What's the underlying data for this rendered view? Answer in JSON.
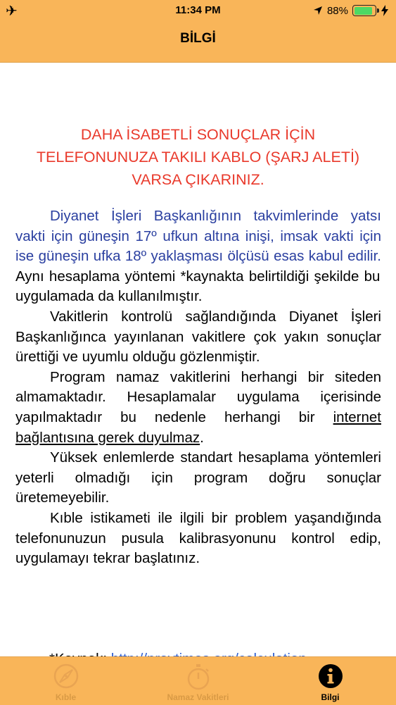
{
  "status_bar": {
    "time": "11:34 PM",
    "battery_percent": "88%",
    "battery_level": 0.88,
    "icons": [
      "airplane-icon",
      "location-arrow-icon",
      "battery-icon",
      "charging-bolt-icon"
    ]
  },
  "nav": {
    "title": "BİLGİ"
  },
  "warning": "DAHA İSABETLİ SONUÇLAR İÇİN TELEFONUNUZA TAKILI KABLO (ŞARJ ALETİ) VARSA ÇIKARINIZ.",
  "paragraphs": {
    "p1_blue": "Diyanet İşleri Başkanlığının takvimlerinde yatsı vakti için güneşin 17º ufkun altına inişi, imsak vakti için ise güneşin ufka 18º yaklaşması ölçüsü esas kabul edilir.",
    "p1_rest": " Aynı hesaplama yöntemi *kaynakta belirtildiği şekilde bu uygulamada da kullanılmıştır.",
    "p2": "Vakitlerin kontrolü sağlandığında Diyanet İşleri Başkanlığınca yayınlanan vakitlere çok yakın sonuçlar ürettiği ve uyumlu olduğu gözlenmiştir.",
    "p3_start": "Program namaz vakitlerini herhangi bir siteden almamaktadır. Hesaplamalar uygulama içerisinde yapılmaktadır bu nedenle herhangi bir ",
    "p3_underline": "internet bağlantısına gerek duyulmaz",
    "p3_end": ".",
    "p4": "Yüksek enlemlerde standart hesaplama yöntemleri yeterli olmadığı için program doğru sonuçlar üretemeyebilir.",
    "p5": "Kıble istikameti ile ilgili bir problem yaşandığında telefonunuzun pusula kalibrasyonunu kontrol edip, uygulamayı tekrar başlatınız."
  },
  "source": {
    "label": "*Kaynak: ",
    "link": "http://praytimes.org/calculation"
  },
  "tabs": [
    {
      "label": "Kıble",
      "icon": "compass-icon",
      "active": false
    },
    {
      "label": "Namaz Vakitleri",
      "icon": "stopwatch-icon",
      "active": false
    },
    {
      "label": "Bilgi",
      "icon": "info-icon",
      "active": true
    }
  ],
  "colors": {
    "bar_background": "#f9b559",
    "warning_red": "#e9392b",
    "body_blue": "#2a3fa0",
    "link_blue": "#2f5fd0",
    "inactive_tab": "#d99a45"
  }
}
